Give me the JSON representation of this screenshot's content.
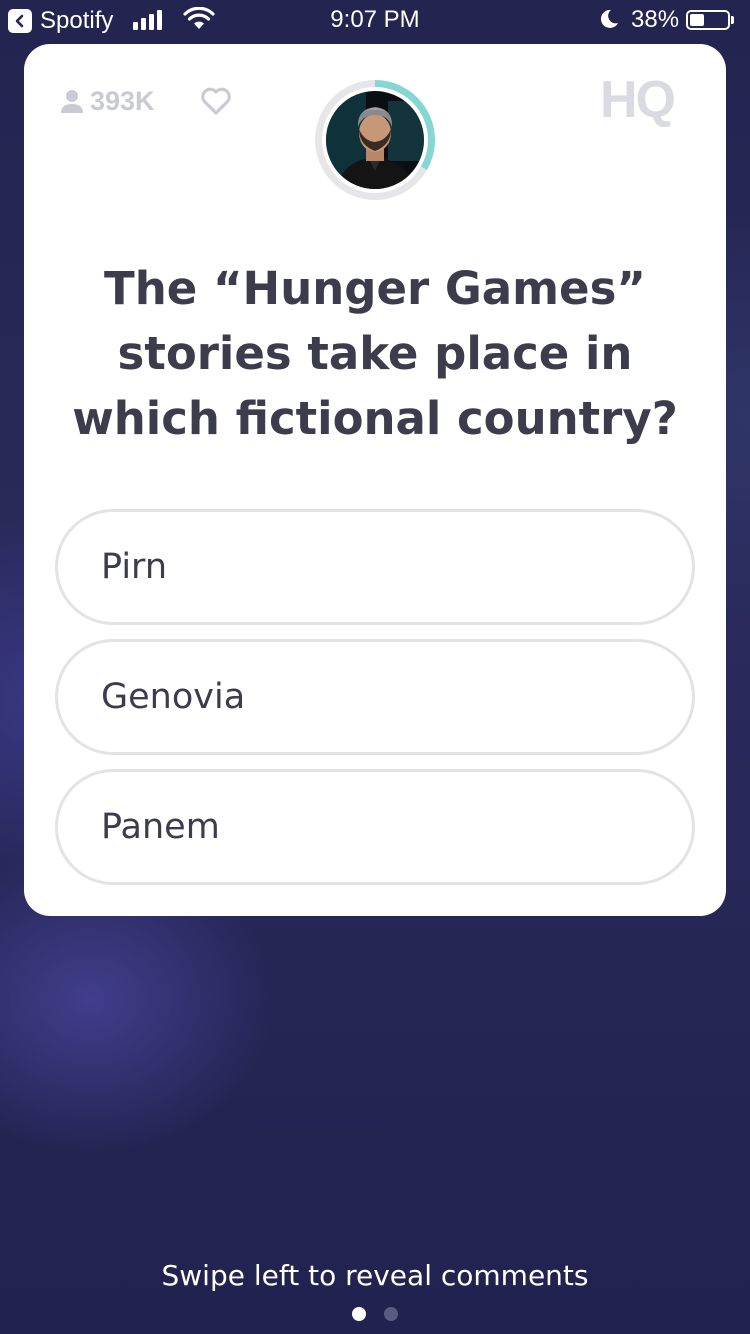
{
  "status_bar": {
    "back_app": "Spotify",
    "time": "9:07 PM",
    "battery": "38%",
    "battery_level": 0.38
  },
  "header": {
    "viewer_count": "393K",
    "logo_text": "HQ"
  },
  "question": {
    "text": "The “Hunger Games” stories take place in which fictional country?"
  },
  "answers": [
    {
      "label": "Pirn"
    },
    {
      "label": "Genovia"
    },
    {
      "label": "Panem"
    }
  ],
  "footer": {
    "hint": "Swipe left to reveal comments",
    "page_count": 2,
    "current_page": 1
  },
  "colors": {
    "card": "#ffffff",
    "question_text": "#3d3c4c",
    "answer_border": "#e3e3e6",
    "muted": "#c9cad3",
    "timer_ring": "#86d6d4"
  }
}
